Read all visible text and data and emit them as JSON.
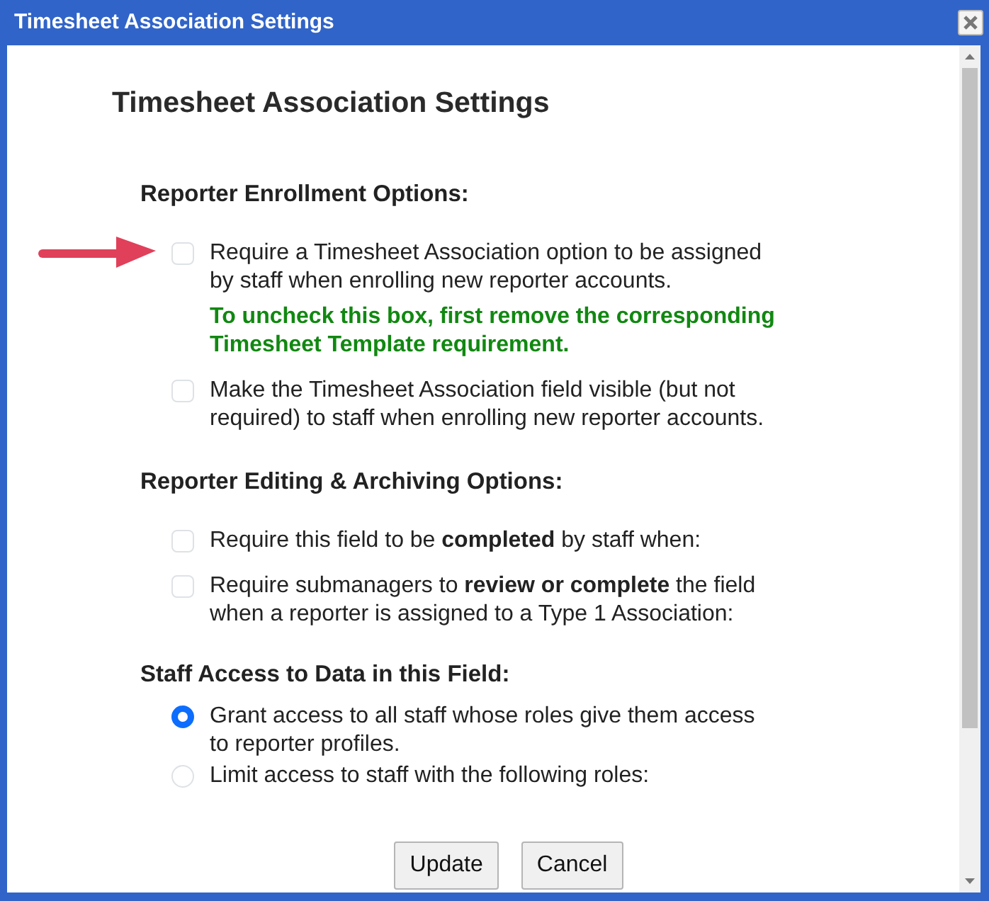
{
  "window": {
    "title": "Timesheet Association Settings"
  },
  "heading": "Timesheet Association Settings",
  "sections": [
    {
      "title": "Reporter Enrollment Options:",
      "options": [
        {
          "kind": "checkbox",
          "text": "Require a Timesheet Association option to be assigned by staff when enrolling new reporter accounts.",
          "checked": false,
          "pointed_at": true,
          "note": "To uncheck this box, first remove the corresponding Timesheet Template requirement."
        },
        {
          "kind": "checkbox",
          "text": "Make the Timesheet Association field visible (but not required) to staff when enrolling new reporter accounts.",
          "checked": false,
          "pointed_at": false
        }
      ]
    },
    {
      "title": "Reporter Editing & Archiving Options:",
      "options": [
        {
          "kind": "checkbox",
          "text": "Require this field to be **completed** by staff when:",
          "checked": false,
          "pointed_at": false
        },
        {
          "kind": "checkbox",
          "text": "Require submanagers to **review or complete** the field when a reporter is assigned to a Type 1 Association:",
          "checked": false,
          "pointed_at": false
        }
      ]
    },
    {
      "title": "Staff Access to Data in this Field:",
      "options": [
        {
          "kind": "radio",
          "text": "Grant access to all staff whose roles give them access to reporter profiles.",
          "selected": true,
          "pointed_at": false
        },
        {
          "kind": "radio",
          "text": "Limit access to staff with the following roles:",
          "selected": false,
          "pointed_at": false
        }
      ]
    }
  ],
  "buttons": [
    "Update",
    "Cancel"
  ]
}
